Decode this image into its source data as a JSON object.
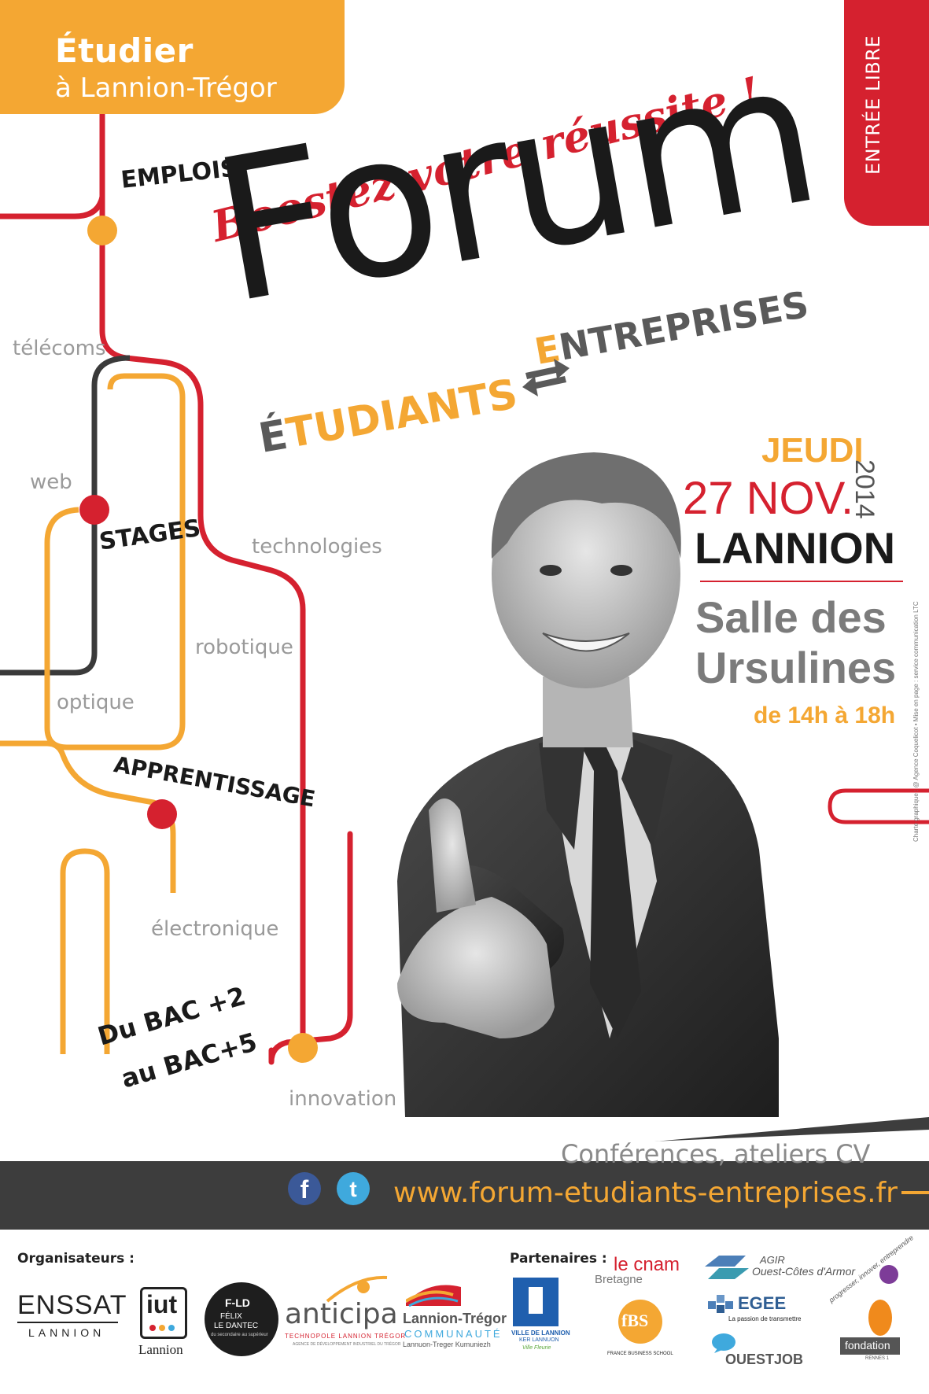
{
  "brand": {
    "line1": "Étudier",
    "line2": "à Lannion-Trégor"
  },
  "entry": "ENTRÉE LIBRE",
  "tags": {
    "emplois": "EMPLOIS",
    "stages": "STAGES",
    "apprentissage": "APPRENTISSAGE",
    "levels_line1": "Du BAC +2",
    "levels_line2": "au BAC+5"
  },
  "fields": [
    "télécoms",
    "web",
    "technologies",
    "robotique",
    "optique",
    "électronique",
    "innovation"
  ],
  "slogan": "Boostez votre réussite !",
  "event": {
    "title": "Forum",
    "word_a_initial": "É",
    "word_a_rest": "TUDIANTS",
    "word_b_initial": "E",
    "word_b_rest": "NTREPRISES",
    "day": "JEUDI",
    "date": "27 NOV.",
    "year": "2014",
    "city": "LANNION",
    "venue_line1": "Salle des",
    "venue_line2": "Ursulines",
    "hours": "de 14h à 18h"
  },
  "activities": "Conférences, ateliers CV",
  "website": "www.forum-etudiants-entreprises.fr",
  "social": {
    "facebook": "f",
    "twitter": "t"
  },
  "credit": "Charte graphique : @ Agence Coquelicot • Mise en page : service communication LTC",
  "footer": {
    "organizers_label": "Organisateurs :",
    "partners_label": "Partenaires :",
    "organizers": {
      "enssat_name": "ENSSAT",
      "enssat_city": "LANNION",
      "iut_name": "iut",
      "iut_city": "Lannion",
      "felix_mark": "F-LD",
      "felix_name1": "FÉLIX",
      "felix_name2": "LE DANTEC",
      "felix_tagline": "du secondaire au supérieur",
      "anticipa_name": "anticipa",
      "anticipa_sub": "TECHNOPOLE LANNION TRÉGOR",
      "anticipa_tagline": "AGENCE DE DÉVELOPPEMENT INDUSTRIEL DU TRÉGOR",
      "ltc_name": "Lannion-Trégor",
      "ltc_sub": "COMMUNAUTÉ",
      "ltc_breton": "Lannuon-Treger Kumuniezh"
    },
    "partners": {
      "ville_name": "VILLE DE LANNION",
      "ville_breton": "KER LANNUON",
      "ville_fleurie": "Ville Fleurie",
      "cnam_le": "le",
      "cnam_name": "cnam",
      "cnam_region": "Bretagne",
      "agir_name": "AGIR",
      "agir_region": "Ouest-Côtes d'Armor",
      "fbs_mark": "fBS",
      "fbs_name": "FRANCE BUSINESS SCHOOL",
      "egee_name": "EGEE",
      "egee_tagline": "La passion de transmettre",
      "ouestjob_name": "OUESTJOB",
      "fondation_name": "fondation",
      "fondation_sub": "RENNES 1",
      "fondation_arc": "progresser, innover, entreprendre"
    }
  },
  "colors": {
    "orange": "#f4a733",
    "red": "#d5212f",
    "dark": "#3a3a3a",
    "grey": "#7b7b7b"
  }
}
